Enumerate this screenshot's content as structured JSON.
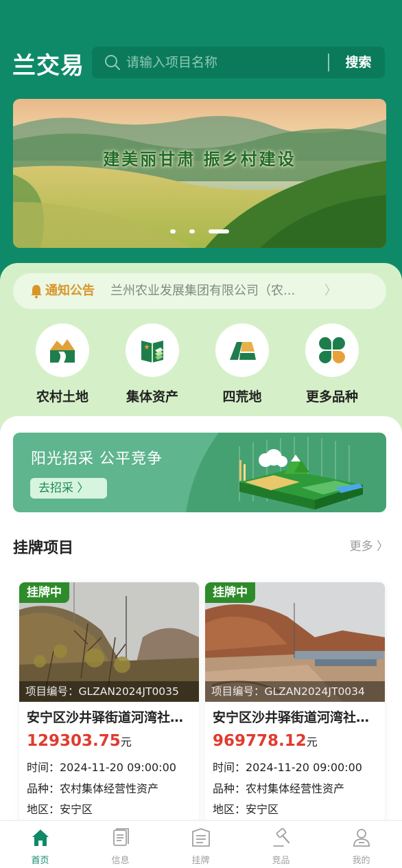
{
  "header": {
    "logo": "兰交易",
    "search_placeholder": "请输入项目名称",
    "search_button": "搜索"
  },
  "banner": {
    "slogan": "建美丽甘肃 振乡村建设",
    "slide_count": 3,
    "active_slide": 3
  },
  "notice": {
    "tag": "通知公告",
    "text": "兰州农业发展集团有限公司（农...",
    "arrow": "〉"
  },
  "categories": [
    {
      "label": "农村土地",
      "icon": "rural-land-icon"
    },
    {
      "label": "集体资产",
      "icon": "collective-assets-icon"
    },
    {
      "label": "四荒地",
      "icon": "wasteland-icon"
    },
    {
      "label": "更多品种",
      "icon": "more-varieties-icon"
    }
  ],
  "promo": {
    "title": "阳光招采  公平竞争",
    "button": "去招采 〉"
  },
  "listing_section": {
    "title": "挂牌项目",
    "more": "更多 〉"
  },
  "listings": [
    {
      "badge": "挂牌中",
      "code": "项目编号：GLZAN2024JT0035",
      "title": "安宁区沙井驿街道河湾社区…",
      "price": "129303.75",
      "unit": "元",
      "time": "时间：2024-11-20 09:00:00",
      "variety": "品种：农村集体经营性资产",
      "region": "地区：安宁区"
    },
    {
      "badge": "挂牌中",
      "code": "项目编号：GLZAN2024JT0034",
      "title": "安宁区沙井驿街道河湾社区…",
      "price": "969778.12",
      "unit": "元",
      "time": "时间：2024-11-20 09:00:00",
      "variety": "品种：农村集体经营性资产",
      "region": "地区：安宁区"
    }
  ],
  "tabbar": [
    {
      "label": "首页",
      "icon": "home-icon",
      "active": true
    },
    {
      "label": "信息",
      "icon": "info-doc-icon",
      "active": false
    },
    {
      "label": "挂牌",
      "icon": "listing-icon",
      "active": false
    },
    {
      "label": "竞品",
      "icon": "auction-hammer-icon",
      "active": false
    },
    {
      "label": "我的",
      "icon": "user-icon",
      "active": false
    }
  ],
  "colors": {
    "brand_green": "#0e8a68",
    "light_green_panel": "#d5f0c8",
    "price_red": "#e03b2f",
    "badge_green": "#2e8b2a",
    "notice_orange": "#d9952a"
  }
}
